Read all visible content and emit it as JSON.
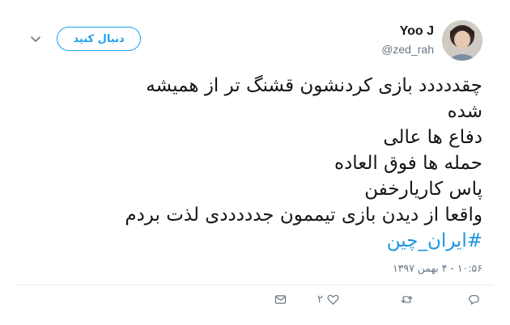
{
  "header": {
    "display_name": "Yoo J",
    "handle": "@zed_rah",
    "follow_label": "دنبال کنید"
  },
  "tweet": {
    "lines": [
      "چقددددد بازی کردنشون قشنگ تر از همیشه",
      "شده",
      "دفاع ها عالی",
      "حمله ها فوق العاده",
      "پاس کاریارخفن",
      "واقعا از دیدن بازی تیممون جدددددی لذت بردم"
    ],
    "hashtag": "#ایران_چین",
    "timestamp": "۱۰:۵۶ - ۴ بهمن ۱۳۹۷"
  },
  "actions": {
    "like_count": "۲"
  },
  "icons": {
    "chevron": "chevron-down-icon",
    "reply": "reply-icon",
    "retweet": "retweet-icon",
    "like": "heart-icon",
    "message": "envelope-icon"
  },
  "colors": {
    "accent": "#1da1f2",
    "hashtag": "#1b95e0",
    "muted": "#657786"
  }
}
